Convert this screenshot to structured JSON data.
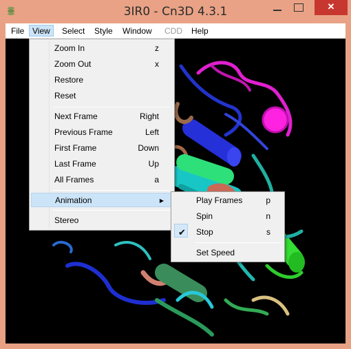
{
  "window": {
    "title": "3IR0 - Cn3D 4.3.1"
  },
  "menubar": {
    "file": "File",
    "view": "View",
    "select": "Select",
    "style": "Style",
    "window": "Window",
    "cdd": "CDD",
    "help": "Help"
  },
  "view_menu": {
    "items": [
      {
        "label": "Zoom In",
        "key": "z"
      },
      {
        "label": "Zoom Out",
        "key": "x"
      },
      {
        "label": "Restore",
        "key": ""
      },
      {
        "label": "Reset",
        "key": ""
      },
      {
        "label": "Next Frame",
        "key": "Right"
      },
      {
        "label": "Previous Frame",
        "key": "Left"
      },
      {
        "label": "First Frame",
        "key": "Down"
      },
      {
        "label": "Last Frame",
        "key": "Up"
      },
      {
        "label": "All Frames",
        "key": "a"
      },
      {
        "label": "Animation",
        "key": ""
      },
      {
        "label": "Stereo",
        "key": ""
      }
    ]
  },
  "animation_menu": {
    "items": [
      {
        "label": "Play Frames",
        "key": "p",
        "checked": false
      },
      {
        "label": "Spin",
        "key": "n",
        "checked": false
      },
      {
        "label": "Stop",
        "key": "s",
        "checked": true
      },
      {
        "label": "Set Speed",
        "key": "",
        "checked": false
      }
    ]
  },
  "colors": {
    "titlebar": "#e9a285",
    "close_button": "#c7372f",
    "menu_highlight": "#cce4f7",
    "viewport_bg": "#000000"
  }
}
